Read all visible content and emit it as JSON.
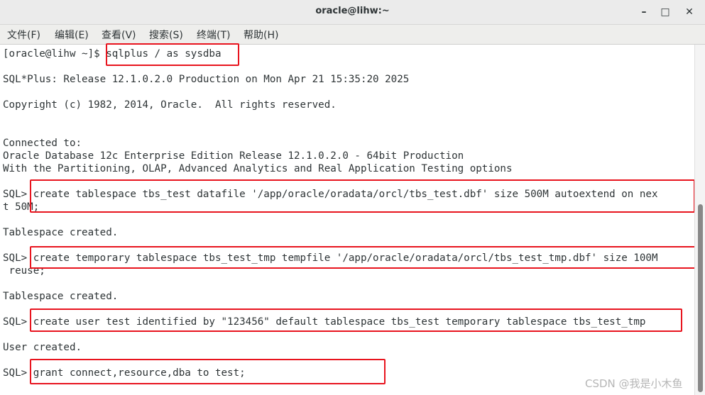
{
  "window": {
    "title": "oracle@lihw:~",
    "minimize_glyph": "–",
    "maximize_glyph": "□",
    "close_glyph": "✕"
  },
  "menu": {
    "items": [
      {
        "label": "文件(F)"
      },
      {
        "label": "编辑(E)"
      },
      {
        "label": "查看(V)"
      },
      {
        "label": "搜索(S)"
      },
      {
        "label": "终端(T)"
      },
      {
        "label": "帮助(H)"
      }
    ]
  },
  "terminal": {
    "lines": [
      "[oracle@lihw ~]$ sqlplus / as sysdba",
      "SQL*Plus: Release 12.1.0.2.0 Production on Mon Apr 21 15:35:20 2025",
      "Copyright (c) 1982, 2014, Oracle.  All rights reserved.",
      "Connected to:",
      "Oracle Database 12c Enterprise Edition Release 12.1.0.2.0 - 64bit Production",
      "With the Partitioning, OLAP, Advanced Analytics and Real Application Testing options",
      "SQL> create tablespace tbs_test datafile '/app/oracle/oradata/orcl/tbs_test.dbf' size 500M autoextend on nex",
      "t 50M;",
      "Tablespace created.",
      "SQL> create temporary tablespace tbs_test_tmp tempfile '/app/oracle/oradata/orcl/tbs_test_tmp.dbf' size 100M",
      " reuse;",
      "Tablespace created.",
      "SQL> create user test identified by \"123456\" default tablespace tbs_test temporary tablespace tbs_test_tmp",
      "User created.",
      "SQL> grant connect,resource,dba to test;"
    ]
  },
  "watermark": "CSDN @我是小木鱼",
  "colors": {
    "highlight": "#e8141e",
    "terminal_text": "#2e3436",
    "titlebar": "#ebebeb"
  }
}
